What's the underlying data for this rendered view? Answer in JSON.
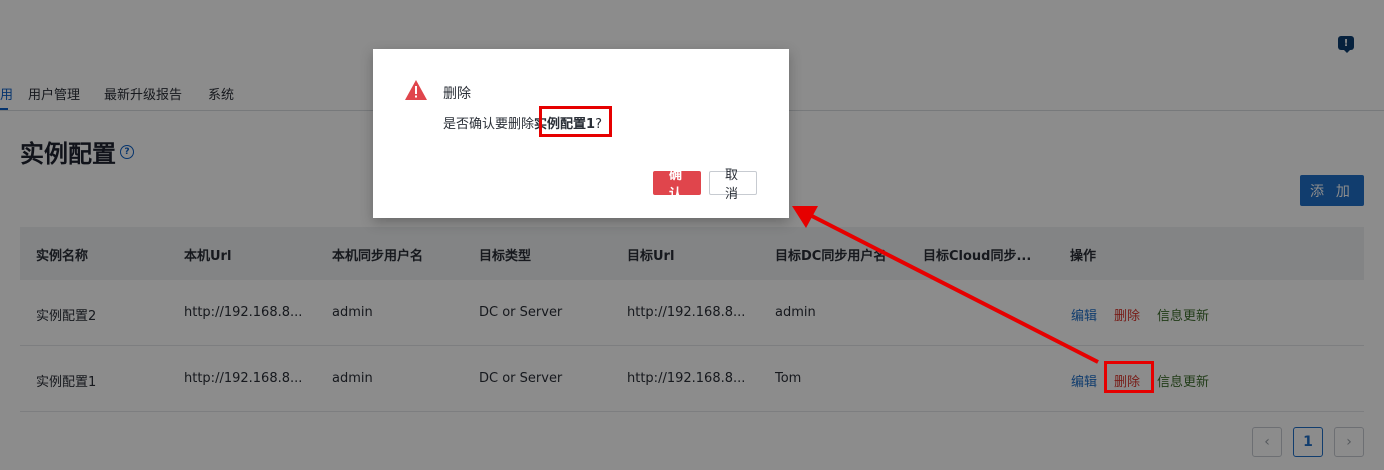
{
  "tabs": {
    "partial": "用",
    "user_management": "用户管理",
    "latest_upgrade_report": "最新升级报告",
    "system": "系统"
  },
  "page": {
    "title": "实例配置",
    "add_label": "添 加"
  },
  "table": {
    "headers": [
      "实例名称",
      "本机Url",
      "本机同步用户名",
      "目标类型",
      "目标Url",
      "目标DC同步用户名",
      "目标Cloud同步...",
      "操作"
    ],
    "rows": [
      {
        "name": "实例配置2",
        "local_url": "http://192.168.8...",
        "local_user": "admin",
        "target_type": "DC or Server",
        "target_url": "http://192.168.8...",
        "dc_user": "admin",
        "cloud_user": ""
      },
      {
        "name": "实例配置1",
        "local_url": "http://192.168.8...",
        "local_user": "admin",
        "target_type": "DC or Server",
        "target_url": "http://192.168.8...",
        "dc_user": "Tom",
        "cloud_user": ""
      }
    ],
    "actions": {
      "edit": "编辑",
      "delete": "删除",
      "update": "信息更新"
    }
  },
  "pagination": {
    "prev": "‹",
    "current": "1",
    "next": "›"
  },
  "modal": {
    "title": "删除",
    "msg_prefix": "是否确认要删除",
    "target_name": "实例配置1",
    "msg_suffix": "?",
    "confirm_label": "确 认",
    "cancel_label": "取 消"
  },
  "colors": {
    "accent": "#1f6fc8",
    "danger": "#e0454c",
    "annotation": "#e60000"
  }
}
